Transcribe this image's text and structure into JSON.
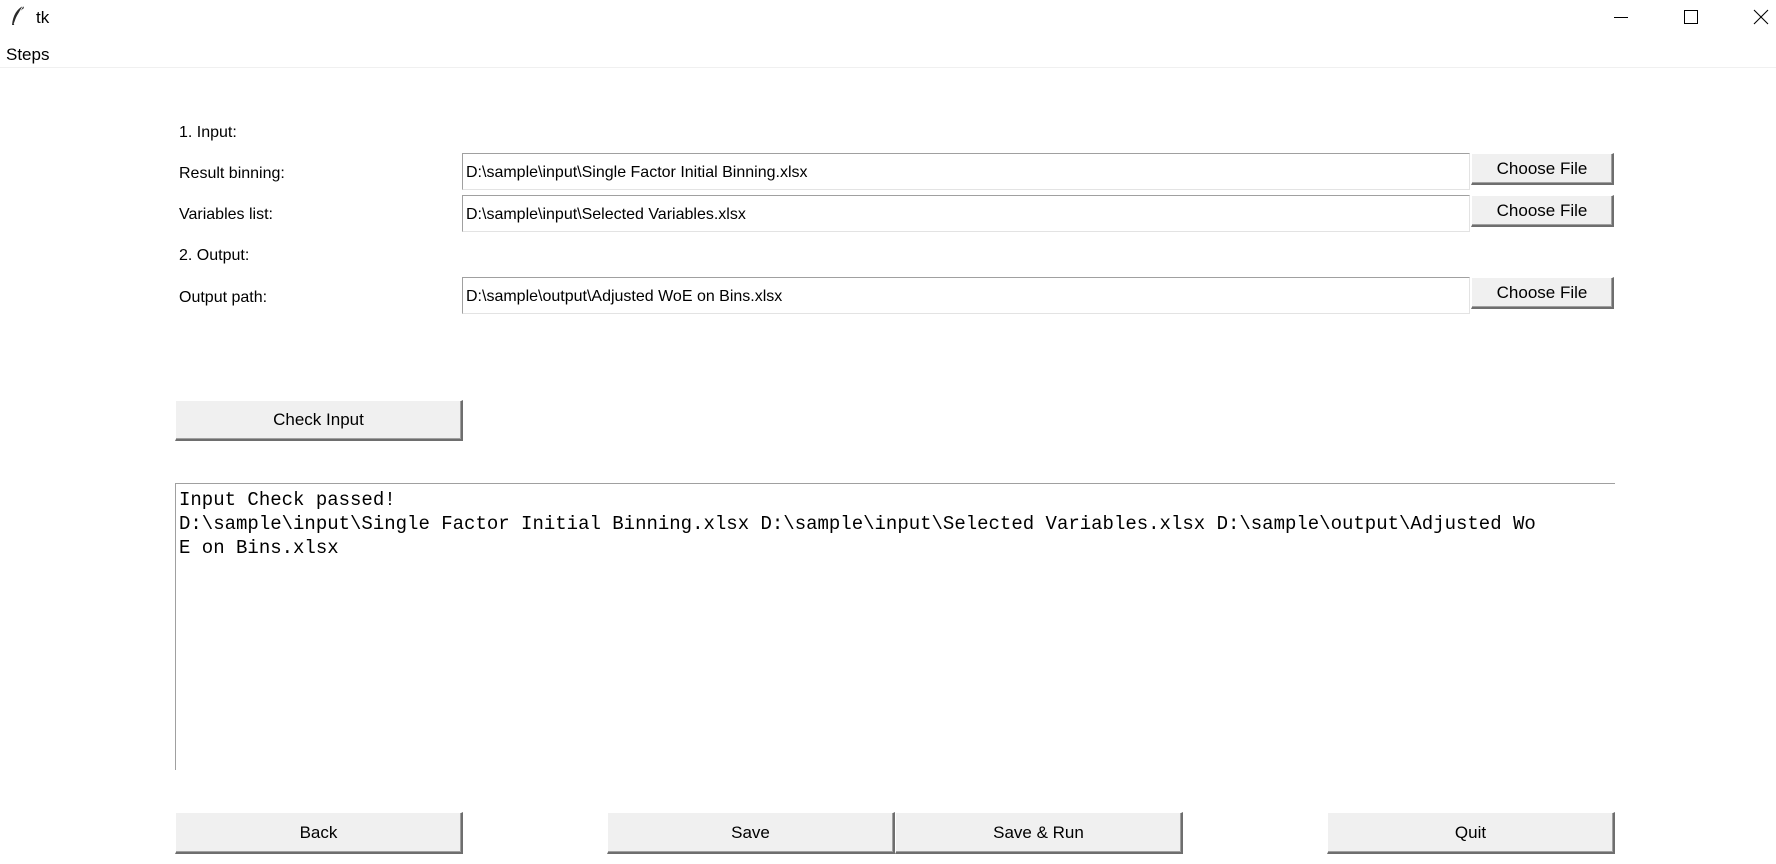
{
  "window": {
    "title": "tk",
    "icons": {
      "app": "feather-icon",
      "minimize": "minimize-icon",
      "maximize": "maximize-icon",
      "close": "close-icon"
    }
  },
  "menu": {
    "items": [
      {
        "label": "Steps"
      }
    ]
  },
  "form": {
    "input_header": "1. Input:",
    "result_binning_label": "Result binning:",
    "result_binning_value": "D:\\sample\\input\\Single Factor Initial Binning.xlsx",
    "variables_list_label": "Variables list:",
    "variables_list_value": "D:\\sample\\input\\Selected Variables.xlsx",
    "output_header": "2. Output:",
    "output_path_label": "Output path:",
    "output_path_value": "D:\\sample\\output\\Adjusted WoE on Bins.xlsx",
    "choose_file_label": "Choose File"
  },
  "actions": {
    "check_input": "Check Input",
    "back": "Back",
    "save": "Save",
    "save_run": "Save & Run",
    "quit": "Quit"
  },
  "console": {
    "lines": [
      "Input Check passed!",
      "D:\\sample\\input\\Single Factor Initial Binning.xlsx D:\\sample\\input\\Selected Variables.xlsx D:\\sample\\output\\Adjusted Wo",
      "E on Bins.xlsx"
    ]
  }
}
